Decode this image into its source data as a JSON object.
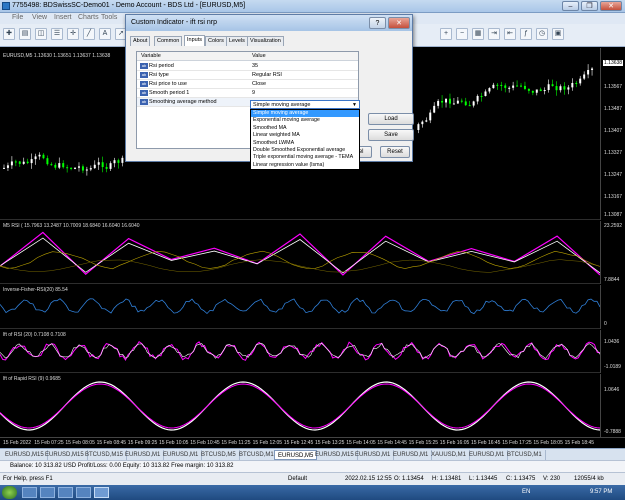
{
  "window": {
    "title": "7755498: BDSwissSC-Demo01 - Demo Account - BDS Ltd - [EURUSD,M5]",
    "min": "–",
    "max": "❐",
    "close": "✕"
  },
  "menu": [
    "File",
    "View",
    "Insert",
    "Charts",
    "Tools"
  ],
  "chart": {
    "main_label": "EURUSD,M5  1.13630  1.13651  1.13637  1.13638",
    "price_scale": [
      "1.13638",
      "1.13567",
      "1.13487",
      "1.13407",
      "1.13327",
      "1.13247",
      "1.13167",
      "1.13087"
    ],
    "panels": [
      {
        "label": "M5 RSI ( 15.7963 13.2487 10.7009 18.6840 16.6040 16.6040",
        "scale_top": "23.2592",
        "scale_bottom": "7.8844"
      },
      {
        "label": "Inverse-Fisher-RSI(20) 85.54",
        "scale_top": "",
        "scale_bottom": "0"
      },
      {
        "label": "lft of RSI (20) 0.7108 0.7108",
        "scale_top": "1.0436",
        "scale_bottom": "-1.0189"
      },
      {
        "label": "lft of Rapid RSI (9) 0.9685",
        "scale_top": "1.0646",
        "scale_bottom": "-0.7888"
      }
    ],
    "time_labels": [
      "15 Feb 2022",
      "15 Feb 07:25",
      "15 Feb 08:05",
      "15 Feb 08:45",
      "15 Feb 09:25",
      "15 Feb 10:05",
      "15 Feb 10:45",
      "15 Feb 11:25",
      "15 Feb 12:05",
      "15 Feb 12:45",
      "15 Feb 13:25",
      "15 Feb 14:05",
      "15 Feb 14:45",
      "15 Feb 15:25",
      "15 Feb 16:05",
      "15 Feb 16:45",
      "15 Feb 17:25",
      "15 Feb 18:05",
      "15 Feb 18:45"
    ]
  },
  "symbol_tabs": [
    "EURUSD,M15",
    "EURUSD,M15",
    "BTCUSD,M15",
    "EURUSD,M1",
    "EURUSD,M1",
    "BTCUSD,M5",
    "BTCUSD,M1",
    "EURUSD,M5",
    "EURUSD,M15",
    "EURUSD,M1",
    "EURUSD,M1",
    "XAUUSD,M1",
    "EURUSD,M1",
    "BTCUSD,M1"
  ],
  "active_tab": 7,
  "balance_line": "Balance: 10 313.82 USD  Profit/Loss: 0.00  Equity: 10 313.82  Free margin: 10 313.82",
  "status": {
    "help": "For Help, press F1",
    "profile": "Default",
    "datetime": "2022.02.15 12:55",
    "open": "O: 1.13454",
    "high": "H: 1.13481",
    "low": "L: 1.13445",
    "close": "C: 1.13475",
    "volume": "V: 230",
    "traffic": "12055/4 kb"
  },
  "taskbar": {
    "lang": "EN",
    "clock": "9:57 PM"
  },
  "dialog": {
    "title": "Custom Indicator - ift rsi nrp",
    "help": "?",
    "close": "✕",
    "tabs": [
      "About",
      "Common",
      "Inputs",
      "Colors",
      "Levels",
      "Visualization"
    ],
    "active_tab": 2,
    "col_variable": "Variable",
    "col_value": "Value",
    "rows": [
      {
        "icon": "ab",
        "name": "Rsi period",
        "value": "35"
      },
      {
        "icon": "ab",
        "name": "Rsi type",
        "value": "Regular RSI"
      },
      {
        "icon": "ab",
        "name": "Rsi price to use",
        "value": "Close"
      },
      {
        "icon": "ab",
        "name": "Smooth period 1",
        "value": "9"
      },
      {
        "icon": "ab",
        "name": "Smoothing average method",
        "value": "Simple moving average"
      }
    ],
    "dropdown_options": [
      "Simple moving average",
      "Exponential moving average",
      "Smoothed MA",
      "Linear weighted MA",
      "Smoothed LWMA",
      "Double Smoothed Exponential average",
      "Triple exponential moving average - TEMA",
      "Linear regression value (lsma)"
    ],
    "selected_option": 0,
    "load_label": "Load",
    "save_label": "Save",
    "cancel_label": "ncel",
    "reset_label": "Reset"
  },
  "colors": {
    "bull": "#ffffff",
    "bear": "#00ff00",
    "magenta": "#ff00ff",
    "olive": "#b8a000",
    "blue": "#2f7fd8"
  }
}
